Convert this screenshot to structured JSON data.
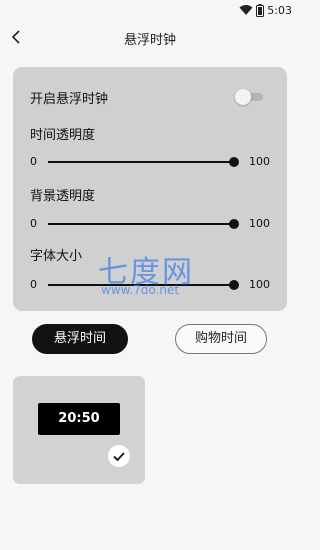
{
  "status_bar": {
    "time": "5:03",
    "wifi_icon": "wifi-icon",
    "battery_icon": "battery-icon"
  },
  "header": {
    "title": "悬浮时钟",
    "back_icon": "chevron-left-icon"
  },
  "settings": {
    "floating_clock_label": "开启悬浮时钟",
    "floating_clock_enabled": false,
    "sliders": [
      {
        "label": "时间透明度",
        "min_label": "0",
        "max_label": "100",
        "value": 100
      },
      {
        "label": "背景透明度",
        "min_label": "0",
        "max_label": "100",
        "value": 100
      },
      {
        "label": "字体大小",
        "min_label": "0",
        "max_label": "100",
        "value": 100
      }
    ]
  },
  "watermark": {
    "title": "七度网",
    "url": "www.7do.net"
  },
  "modes": {
    "active_label": "悬浮时间",
    "inactive_label": "购物时间"
  },
  "style_preview": {
    "clock_text": "20:50",
    "selected": true
  },
  "colors": {
    "card_bg": "#d0d0d0",
    "accent": "#111111",
    "watermark": "#4682e6"
  }
}
